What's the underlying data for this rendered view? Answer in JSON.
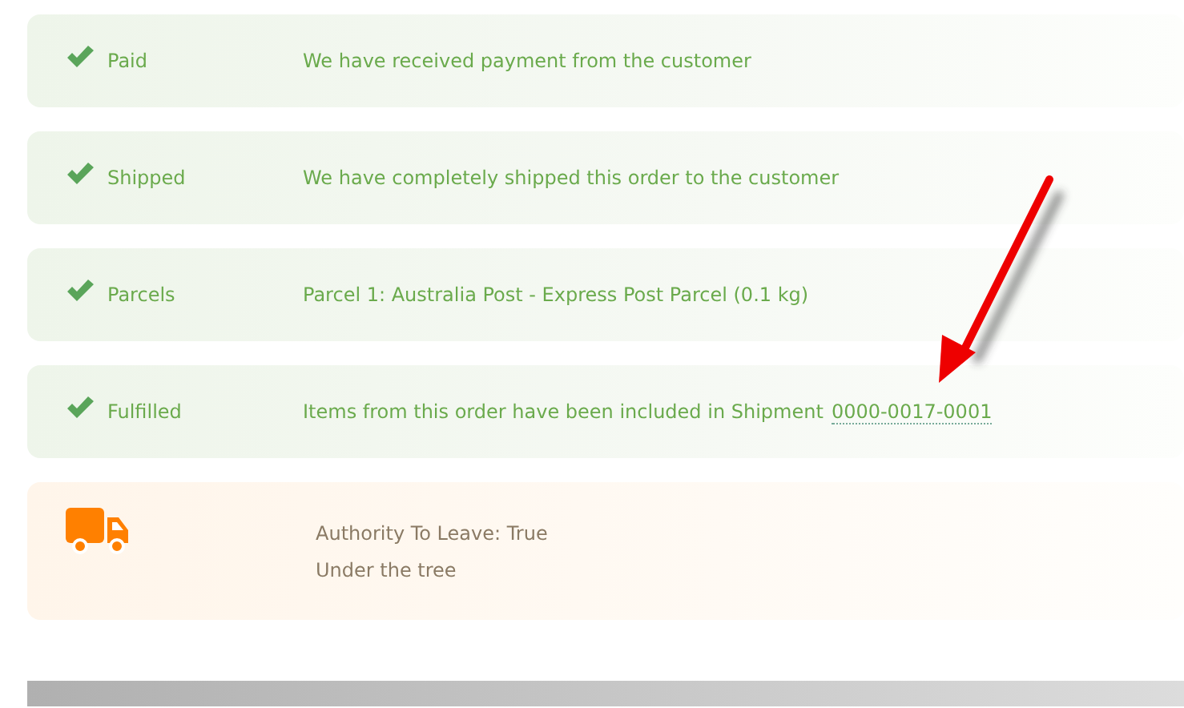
{
  "steps": [
    {
      "kind": "status",
      "label": "Paid",
      "message": "We have received payment from the customer"
    },
    {
      "kind": "status",
      "label": "Shipped",
      "message": "We have completely shipped this order to the customer"
    },
    {
      "kind": "status",
      "label": "Parcels",
      "message": "Parcel 1: Australia Post - Express Post Parcel (0.1 kg)"
    },
    {
      "kind": "status",
      "label": "Fulfilled",
      "message": "Items from this order have been included in Shipment",
      "link": "0000-0017-0001"
    },
    {
      "kind": "note",
      "lines": [
        "Authority To Leave: True",
        "Under the tree"
      ]
    }
  ]
}
